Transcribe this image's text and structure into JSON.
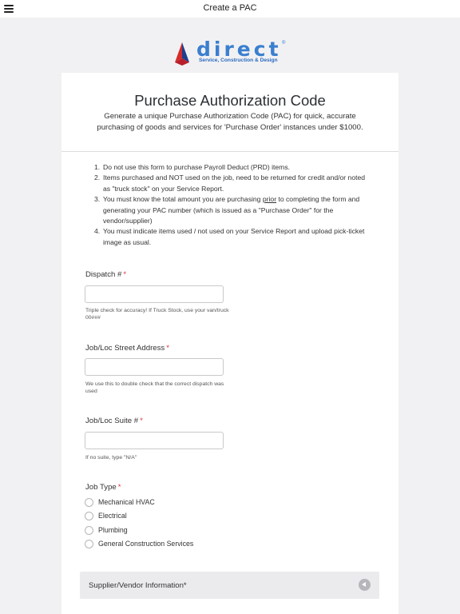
{
  "header": {
    "title": "Create a PAC"
  },
  "logo": {
    "word": "direct",
    "reg": "®",
    "tagline": "Service, Construction & Design"
  },
  "form": {
    "title": "Purchase Authorization Code",
    "subtitle": "Generate a unique Purchase Authorization Code (PAC) for quick, accurate purchasing of goods and services for 'Purchase Order' instances under $1000.",
    "instructions": [
      {
        "num": "1.",
        "text": "Do not use this form to purchase Payroll Deduct (PRD) items."
      },
      {
        "num": "2.",
        "text": "Items purchased and NOT used on the job, need to be returned for credit and/or noted as \"truck stock\" on your Service Report."
      },
      {
        "num": "3.",
        "before": "You must know the total amount you are purchasing ",
        "underlined": "prior",
        "after": " to completing the form and generating your PAC number (which is issued as a \"Purchase Order\" for the vendor/supplier)"
      },
      {
        "num": "4.",
        "text": "You must indicate items used / not used on your Service Report and upload pick-ticket image as usual."
      }
    ],
    "required_mark": "*",
    "fields": {
      "dispatch": {
        "label": "Dispatch #",
        "value": "",
        "helper": "Triple check for accuracy! If Truck Stock, use your van/truck 00###"
      },
      "address": {
        "label": "Job/Loc Street Address",
        "value": "",
        "helper": "We use this to double check that the correct dispatch was used"
      },
      "suite": {
        "label": "Job/Loc Suite #",
        "value": "",
        "helper": "If no suite, type \"N/A\""
      }
    },
    "job_type": {
      "label": "Job Type",
      "options": [
        "Mechanical HVAC",
        "Electrical",
        "Plumbing",
        "General Construction Services"
      ]
    },
    "section": {
      "title": "Supplier/Vendor Information*"
    }
  },
  "colors": {
    "accent_blue": "#3a7fcf",
    "required_red": "#d9363e",
    "logo_red": "#d42b2b",
    "logo_navy": "#1d3f8c"
  }
}
